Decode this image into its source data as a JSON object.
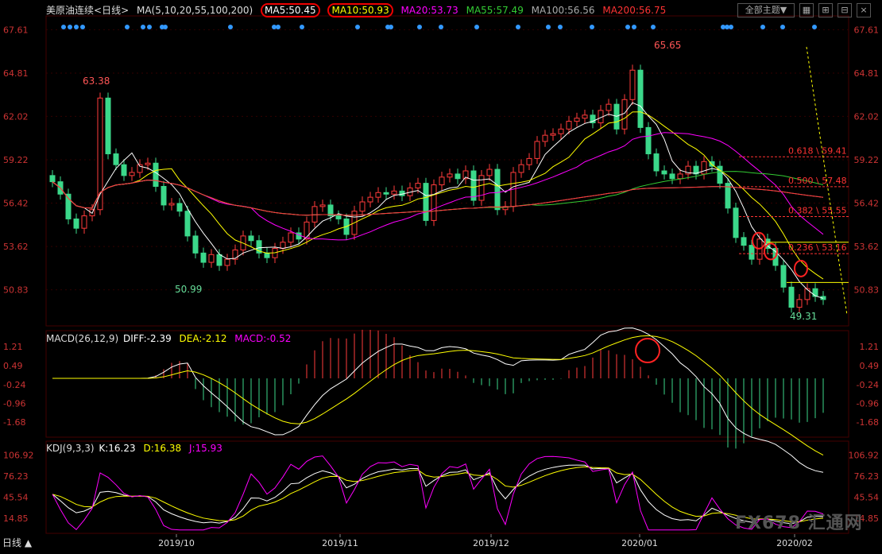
{
  "header": {
    "symbol": "美原油连续",
    "period_tab": "<日线>",
    "ma_label": "MA(5,10,20,55,100,200)",
    "ma_values": [
      {
        "label": "MA5:50.45",
        "color": "#ffffff"
      },
      {
        "label": "MA10:50.93",
        "color": "#ffff00"
      },
      {
        "label": "MA20:53.73",
        "color": "#ff00ff"
      },
      {
        "label": "MA55:57.49",
        "color": "#33cc33"
      },
      {
        "label": "MA100:56.56",
        "color": "#aaaaaa"
      },
      {
        "label": "MA200:56.75",
        "color": "#ff3333"
      }
    ],
    "theme_button": "全部主题▼",
    "icons": [
      "grid-icon",
      "expand-icon",
      "minimize-icon",
      "close-icon"
    ]
  },
  "price_axis": {
    "ticks": [
      "67.61",
      "64.81",
      "62.02",
      "59.22",
      "56.42",
      "53.62",
      "50.83"
    ],
    "values": [
      67.61,
      64.81,
      62.02,
      59.22,
      56.42,
      53.62,
      50.83
    ]
  },
  "price_labels": {
    "high1": "63.38",
    "low1": "50.99",
    "high2": "65.65",
    "low2": "49.31"
  },
  "fib_levels": [
    {
      "label": "0.618 \\ 59.41",
      "value": 59.41
    },
    {
      "label": "0.500 \\ 57.48",
      "value": 57.48
    },
    {
      "label": "0.382 \\ 55.55",
      "value": 55.55
    },
    {
      "label": "0.236 \\ 53.16",
      "value": 53.16
    }
  ],
  "macd": {
    "label": "MACD(26,12,9)",
    "diff": "DIFF:-2.39",
    "dea": "DEA:-2.12",
    "macd": "MACD:-0.52",
    "ticks": [
      "1.21",
      "0.49",
      "-0.24",
      "-0.96",
      "-1.68"
    ]
  },
  "kdj": {
    "label": "KDJ(9,3,3)",
    "k": "K:16.23",
    "d": "D:16.38",
    "j": "J:15.93",
    "ticks": [
      "106.92",
      "76.23",
      "45.54",
      "14.85"
    ]
  },
  "x_axis": {
    "labels": [
      "2019/10",
      "2019/11",
      "2019/12",
      "2020/01",
      "2020/02"
    ]
  },
  "period_button": "日线 ▲",
  "watermark": "FX678 汇通网",
  "colors": {
    "up": "#ff3b3b",
    "down": "#3bd88a",
    "grid": "#5a0000",
    "axis": "#cc3333"
  },
  "chart_data": {
    "type": "candlestick",
    "title": "美原油连续",
    "ylim": [
      48.5,
      68.5
    ],
    "series": [
      {
        "name": "MA5",
        "values": []
      },
      {
        "name": "MA10",
        "values": []
      },
      {
        "name": "MA20",
        "values": []
      },
      {
        "name": "MA55",
        "values": []
      },
      {
        "name": "MA100",
        "values": []
      },
      {
        "name": "MA200",
        "values": []
      }
    ],
    "candles_close": [
      57.8,
      57.0,
      55.4,
      54.8,
      55.6,
      56.0,
      63.2,
      59.6,
      58.9,
      58.2,
      58.4,
      58.9,
      59.0,
      57.5,
      56.3,
      56.4,
      55.9,
      54.3,
      53.2,
      52.6,
      53.1,
      52.4,
      52.8,
      53.4,
      54.3,
      54.0,
      53.2,
      52.9,
      53.5,
      53.9,
      54.5,
      54.1,
      55.2,
      56.2,
      56.3,
      55.6,
      55.4,
      54.4,
      55.9,
      56.5,
      56.8,
      57.1,
      57.0,
      57.2,
      56.9,
      57.4,
      57.7,
      55.3,
      57.6,
      58.1,
      58.3,
      58.0,
      58.5,
      56.6,
      58.2,
      58.6,
      56.0,
      56.2,
      58.4,
      58.9,
      59.3,
      60.4,
      60.8,
      60.9,
      61.2,
      61.7,
      61.9,
      62.1,
      61.6,
      62.4,
      62.8,
      61.2,
      63.1,
      65.0,
      61.3,
      59.6,
      58.5,
      58.3,
      58.0,
      58.3,
      58.8,
      58.3,
      59.1,
      58.8,
      57.7,
      56.1,
      54.2,
      53.7,
      52.8,
      54.1,
      53.5,
      52.4,
      51.0,
      49.7,
      50.2,
      50.9,
      50.4,
      50.2
    ],
    "macd_hist": [],
    "kdj": []
  }
}
